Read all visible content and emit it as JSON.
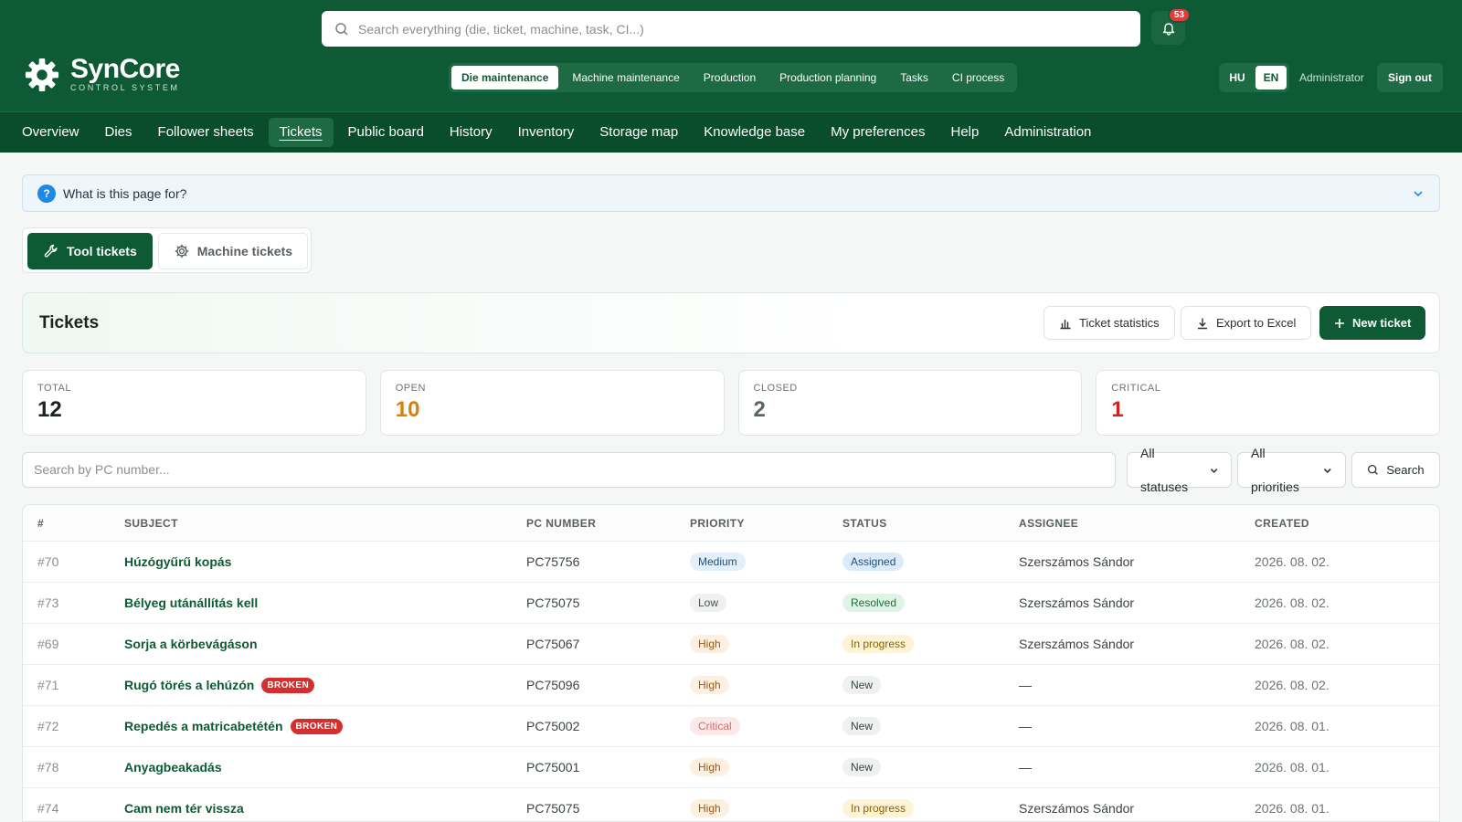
{
  "header": {
    "search_placeholder": "Search everything (die, ticket, machine, task, CI...)",
    "notifications_count": "53",
    "logo_name": "SynCore",
    "logo_sub": "CONTROL SYSTEM",
    "domain_tabs": [
      "Die maintenance",
      "Machine maintenance",
      "Production",
      "Production planning",
      "Tasks",
      "CI process"
    ],
    "languages": [
      "HU",
      "EN"
    ],
    "active_language": "EN",
    "user": "Administrator",
    "sign_out": "Sign out"
  },
  "nav": [
    "Overview",
    "Dies",
    "Follower sheets",
    "Tickets",
    "Public board",
    "History",
    "Inventory",
    "Storage map",
    "Knowledge base",
    "My preferences",
    "Help",
    "Administration"
  ],
  "help": {
    "question": "What is this page for?"
  },
  "type_tabs": {
    "tool": "Tool tickets",
    "machine": "Machine tickets"
  },
  "tickets": {
    "title": "Tickets",
    "statistics": "Ticket statistics",
    "export": "Export to Excel",
    "new": "New ticket"
  },
  "stats": [
    {
      "label": "TOTAL",
      "value": "12",
      "color": "#1b2420"
    },
    {
      "label": "OPEN",
      "value": "10",
      "color": "#d9800c"
    },
    {
      "label": "CLOSED",
      "value": "2",
      "color": "#59656c"
    },
    {
      "label": "CRITICAL",
      "value": "1",
      "color": "#c62828"
    }
  ],
  "filter": {
    "search_placeholder": "Search by PC number...",
    "status": "All statuses",
    "priority": "All priorities",
    "search_button": "Search"
  },
  "table": {
    "columns": [
      "#",
      "SUBJECT",
      "PC NUMBER",
      "PRIORITY",
      "STATUS",
      "ASSIGNEE",
      "CREATED"
    ],
    "rows": [
      {
        "id": "#70",
        "subject": "Húzógyűrű kopás",
        "broken": "",
        "pc": "PC75756",
        "priority": "Medium",
        "status": "Assigned",
        "assignee": "Szerszámos Sándor",
        "created": "2026. 08. 02."
      },
      {
        "id": "#73",
        "subject": "Bélyeg utánállítás kell",
        "broken": "",
        "pc": "PC75075",
        "priority": "Low",
        "status": "Resolved",
        "assignee": "Szerszámos Sándor",
        "created": "2026. 08. 02."
      },
      {
        "id": "#69",
        "subject": "Sorja a körbevágáson",
        "broken": "",
        "pc": "PC75067",
        "priority": "High",
        "status": "In progress",
        "assignee": "Szerszámos Sándor",
        "created": "2026. 08. 02."
      },
      {
        "id": "#71",
        "subject": "Rugó törés a lehúzón",
        "broken": "BROKEN",
        "pc": "PC75096",
        "priority": "High",
        "status": "New",
        "assignee": "—",
        "created": "2026. 08. 02."
      },
      {
        "id": "#72",
        "subject": "Repedés a matricabetétén",
        "broken": "BROKEN",
        "pc": "PC75002",
        "priority": "Critical",
        "status": "New",
        "assignee": "—",
        "created": "2026. 08. 01."
      },
      {
        "id": "#78",
        "subject": "Anyagbeakadás",
        "broken": "",
        "pc": "PC75001",
        "priority": "High",
        "status": "New",
        "assignee": "—",
        "created": "2026. 08. 01."
      },
      {
        "id": "#74",
        "subject": "Cam nem tér vissza",
        "broken": "",
        "pc": "PC75075",
        "priority": "High",
        "status": "In progress",
        "assignee": "Szerszámos Sándor",
        "created": "2026. 08. 01."
      }
    ]
  },
  "colors": {
    "brand": "#0d5a34",
    "priority": {
      "Medium": {
        "bg": "#e3f0fb",
        "fg": "#1e4f7a"
      },
      "Low": {
        "bg": "#eef1f0",
        "fg": "#4a524e"
      },
      "High": {
        "bg": "#fdf0e1",
        "fg": "#9a5a12"
      },
      "Critical": {
        "bg": "#fbe9e9",
        "fg": "#d07070"
      }
    },
    "status": {
      "Assigned": {
        "bg": "#dcebf9",
        "fg": "#1e4f7a"
      },
      "Resolved": {
        "bg": "#dff3e6",
        "fg": "#1f6b3d"
      },
      "In progress": {
        "bg": "#fdf3d6",
        "fg": "#8a6200"
      },
      "New": {
        "bg": "#eef1f0",
        "fg": "#3a4440"
      }
    }
  }
}
